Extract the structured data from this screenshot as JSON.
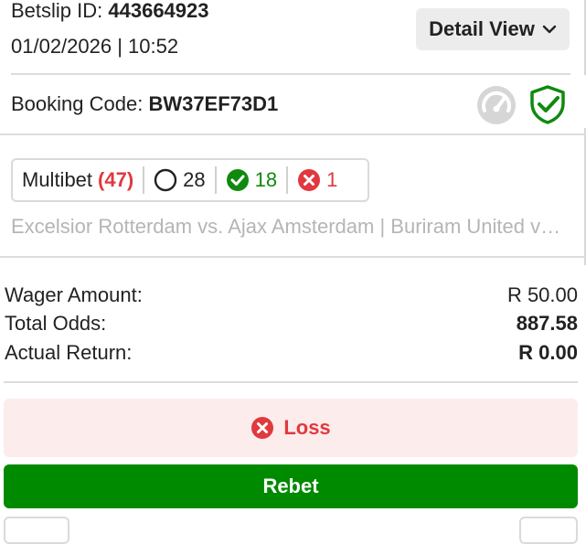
{
  "header": {
    "betslip_label": "Betslip ID: ",
    "betslip_id": "443664923",
    "date_time": "01/02/2026 | 10:52",
    "detail_view_label": "Detail View"
  },
  "booking": {
    "label": "Booking Code: ",
    "code": "BW37EF73D1"
  },
  "summary": {
    "type_label": "Multibet",
    "type_count": "(47)",
    "open_count": "28",
    "won_count": "18",
    "lost_count": "1"
  },
  "events_text": "Excelsior Rotterdam vs. Ajax Amsterdam | Buriram United vs. Bangkok United | Teams",
  "totals": {
    "wager_label": "Wager Amount:",
    "wager_value": "R 50.00",
    "odds_label": "Total Odds:",
    "odds_value": "887.58",
    "return_label": "Actual Return:",
    "return_value": "R 0.00"
  },
  "status": {
    "label": "Loss"
  },
  "rebet_label": "Rebet",
  "colors": {
    "green": "#008a00",
    "red": "#e0393e",
    "loss_bg": "#fdecec"
  }
}
